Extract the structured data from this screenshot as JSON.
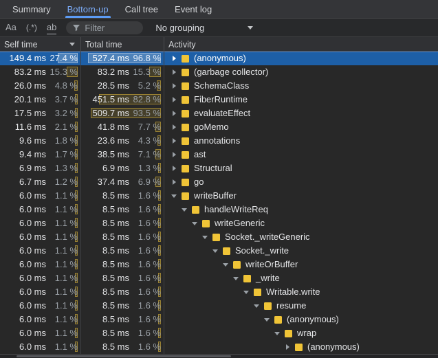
{
  "tabs": {
    "items": [
      {
        "label": "Summary",
        "selected": false
      },
      {
        "label": "Bottom-up",
        "selected": true
      },
      {
        "label": "Call tree",
        "selected": false
      },
      {
        "label": "Event log",
        "selected": false
      }
    ]
  },
  "toolbar": {
    "match_case_label": "Aa",
    "regex_label": "(.*)",
    "whole_word_label": "ab",
    "filter_placeholder": "Filter",
    "grouping_value": "No grouping"
  },
  "grid": {
    "columns": [
      {
        "label": "Self time",
        "sort": "desc"
      },
      {
        "label": "Total time",
        "sort": null
      },
      {
        "label": "Activity",
        "sort": null
      }
    ],
    "rows": [
      {
        "self_ms": "149.4 ms",
        "self_pct": "27.4 %",
        "self_pct_value": 27.4,
        "total_ms": "527.4 ms",
        "total_pct": "96.8 %",
        "total_pct_value": 96.8,
        "name": "(anonymous)",
        "level": 0,
        "expanded": false,
        "selected": true
      },
      {
        "self_ms": "83.2 ms",
        "self_pct": "15.3 %",
        "self_pct_value": 15.3,
        "total_ms": "83.2 ms",
        "total_pct": "15.3 %",
        "total_pct_value": 15.3,
        "name": "(garbage collector)",
        "level": 0,
        "expanded": false,
        "selected": false
      },
      {
        "self_ms": "26.0 ms",
        "self_pct": "4.8 %",
        "self_pct_value": 4.8,
        "total_ms": "28.5 ms",
        "total_pct": "5.2 %",
        "total_pct_value": 5.2,
        "name": "SchemaClass",
        "level": 0,
        "expanded": false,
        "selected": false
      },
      {
        "self_ms": "20.1 ms",
        "self_pct": "3.7 %",
        "self_pct_value": 3.7,
        "total_ms": "451.5 ms",
        "total_pct": "82.8 %",
        "total_pct_value": 82.8,
        "name": "FiberRuntime",
        "level": 0,
        "expanded": false,
        "selected": false
      },
      {
        "self_ms": "17.5 ms",
        "self_pct": "3.2 %",
        "self_pct_value": 3.2,
        "total_ms": "509.7 ms",
        "total_pct": "93.5 %",
        "total_pct_value": 93.5,
        "name": "evaluateEffect",
        "level": 0,
        "expanded": false,
        "selected": false
      },
      {
        "self_ms": "11.6 ms",
        "self_pct": "2.1 %",
        "self_pct_value": 2.1,
        "total_ms": "41.8 ms",
        "total_pct": "7.7 %",
        "total_pct_value": 7.7,
        "name": "goMemo",
        "level": 0,
        "expanded": false,
        "selected": false
      },
      {
        "self_ms": "9.6 ms",
        "self_pct": "1.8 %",
        "self_pct_value": 1.8,
        "total_ms": "23.6 ms",
        "total_pct": "4.3 %",
        "total_pct_value": 4.3,
        "name": "annotations",
        "level": 0,
        "expanded": false,
        "selected": false
      },
      {
        "self_ms": "9.4 ms",
        "self_pct": "1.7 %",
        "self_pct_value": 1.7,
        "total_ms": "38.5 ms",
        "total_pct": "7.1 %",
        "total_pct_value": 7.1,
        "name": "ast",
        "level": 0,
        "expanded": false,
        "selected": false
      },
      {
        "self_ms": "6.9 ms",
        "self_pct": "1.3 %",
        "self_pct_value": 1.3,
        "total_ms": "6.9 ms",
        "total_pct": "1.3 %",
        "total_pct_value": 1.3,
        "name": "Structural",
        "level": 0,
        "expanded": false,
        "selected": false
      },
      {
        "self_ms": "6.7 ms",
        "self_pct": "1.2 %",
        "self_pct_value": 1.2,
        "total_ms": "37.4 ms",
        "total_pct": "6.9 %",
        "total_pct_value": 6.9,
        "name": "go",
        "level": 0,
        "expanded": false,
        "selected": false
      },
      {
        "self_ms": "6.0 ms",
        "self_pct": "1.1 %",
        "self_pct_value": 1.1,
        "total_ms": "8.5 ms",
        "total_pct": "1.6 %",
        "total_pct_value": 1.6,
        "name": "writeBuffer",
        "level": 0,
        "expanded": true,
        "selected": false
      },
      {
        "self_ms": "6.0 ms",
        "self_pct": "1.1 %",
        "self_pct_value": 1.1,
        "total_ms": "8.5 ms",
        "total_pct": "1.6 %",
        "total_pct_value": 1.6,
        "name": "handleWriteReq",
        "level": 1,
        "expanded": true,
        "selected": false
      },
      {
        "self_ms": "6.0 ms",
        "self_pct": "1.1 %",
        "self_pct_value": 1.1,
        "total_ms": "8.5 ms",
        "total_pct": "1.6 %",
        "total_pct_value": 1.6,
        "name": "writeGeneric",
        "level": 2,
        "expanded": true,
        "selected": false
      },
      {
        "self_ms": "6.0 ms",
        "self_pct": "1.1 %",
        "self_pct_value": 1.1,
        "total_ms": "8.5 ms",
        "total_pct": "1.6 %",
        "total_pct_value": 1.6,
        "name": "Socket._writeGeneric",
        "level": 3,
        "expanded": true,
        "selected": false
      },
      {
        "self_ms": "6.0 ms",
        "self_pct": "1.1 %",
        "self_pct_value": 1.1,
        "total_ms": "8.5 ms",
        "total_pct": "1.6 %",
        "total_pct_value": 1.6,
        "name": "Socket._write",
        "level": 4,
        "expanded": true,
        "selected": false
      },
      {
        "self_ms": "6.0 ms",
        "self_pct": "1.1 %",
        "self_pct_value": 1.1,
        "total_ms": "8.5 ms",
        "total_pct": "1.6 %",
        "total_pct_value": 1.6,
        "name": "writeOrBuffer",
        "level": 5,
        "expanded": true,
        "selected": false
      },
      {
        "self_ms": "6.0 ms",
        "self_pct": "1.1 %",
        "self_pct_value": 1.1,
        "total_ms": "8.5 ms",
        "total_pct": "1.6 %",
        "total_pct_value": 1.6,
        "name": "_write",
        "level": 6,
        "expanded": true,
        "selected": false
      },
      {
        "self_ms": "6.0 ms",
        "self_pct": "1.1 %",
        "self_pct_value": 1.1,
        "total_ms": "8.5 ms",
        "total_pct": "1.6 %",
        "total_pct_value": 1.6,
        "name": "Writable.write",
        "level": 7,
        "expanded": true,
        "selected": false
      },
      {
        "self_ms": "6.0 ms",
        "self_pct": "1.1 %",
        "self_pct_value": 1.1,
        "total_ms": "8.5 ms",
        "total_pct": "1.6 %",
        "total_pct_value": 1.6,
        "name": "resume",
        "level": 8,
        "expanded": true,
        "selected": false
      },
      {
        "self_ms": "6.0 ms",
        "self_pct": "1.1 %",
        "self_pct_value": 1.1,
        "total_ms": "8.5 ms",
        "total_pct": "1.6 %",
        "total_pct_value": 1.6,
        "name": "(anonymous)",
        "level": 9,
        "expanded": true,
        "selected": false
      },
      {
        "self_ms": "6.0 ms",
        "self_pct": "1.1 %",
        "self_pct_value": 1.1,
        "total_ms": "8.5 ms",
        "total_pct": "1.6 %",
        "total_pct_value": 1.6,
        "name": "wrap",
        "level": 10,
        "expanded": true,
        "selected": false
      },
      {
        "self_ms": "6.0 ms",
        "self_pct": "1.1 %",
        "self_pct_value": 1.1,
        "total_ms": "8.5 ms",
        "total_pct": "1.6 %",
        "total_pct_value": 1.6,
        "name": "(anonymous)",
        "level": 11,
        "expanded": false,
        "selected": false
      }
    ]
  },
  "colors": {
    "accent_blue": "#7cacf8",
    "selection_blue": "#1d5fa7",
    "heat_yellow": "#deb83a",
    "function_icon_yellow": "#f0c437",
    "background": "#282828"
  }
}
